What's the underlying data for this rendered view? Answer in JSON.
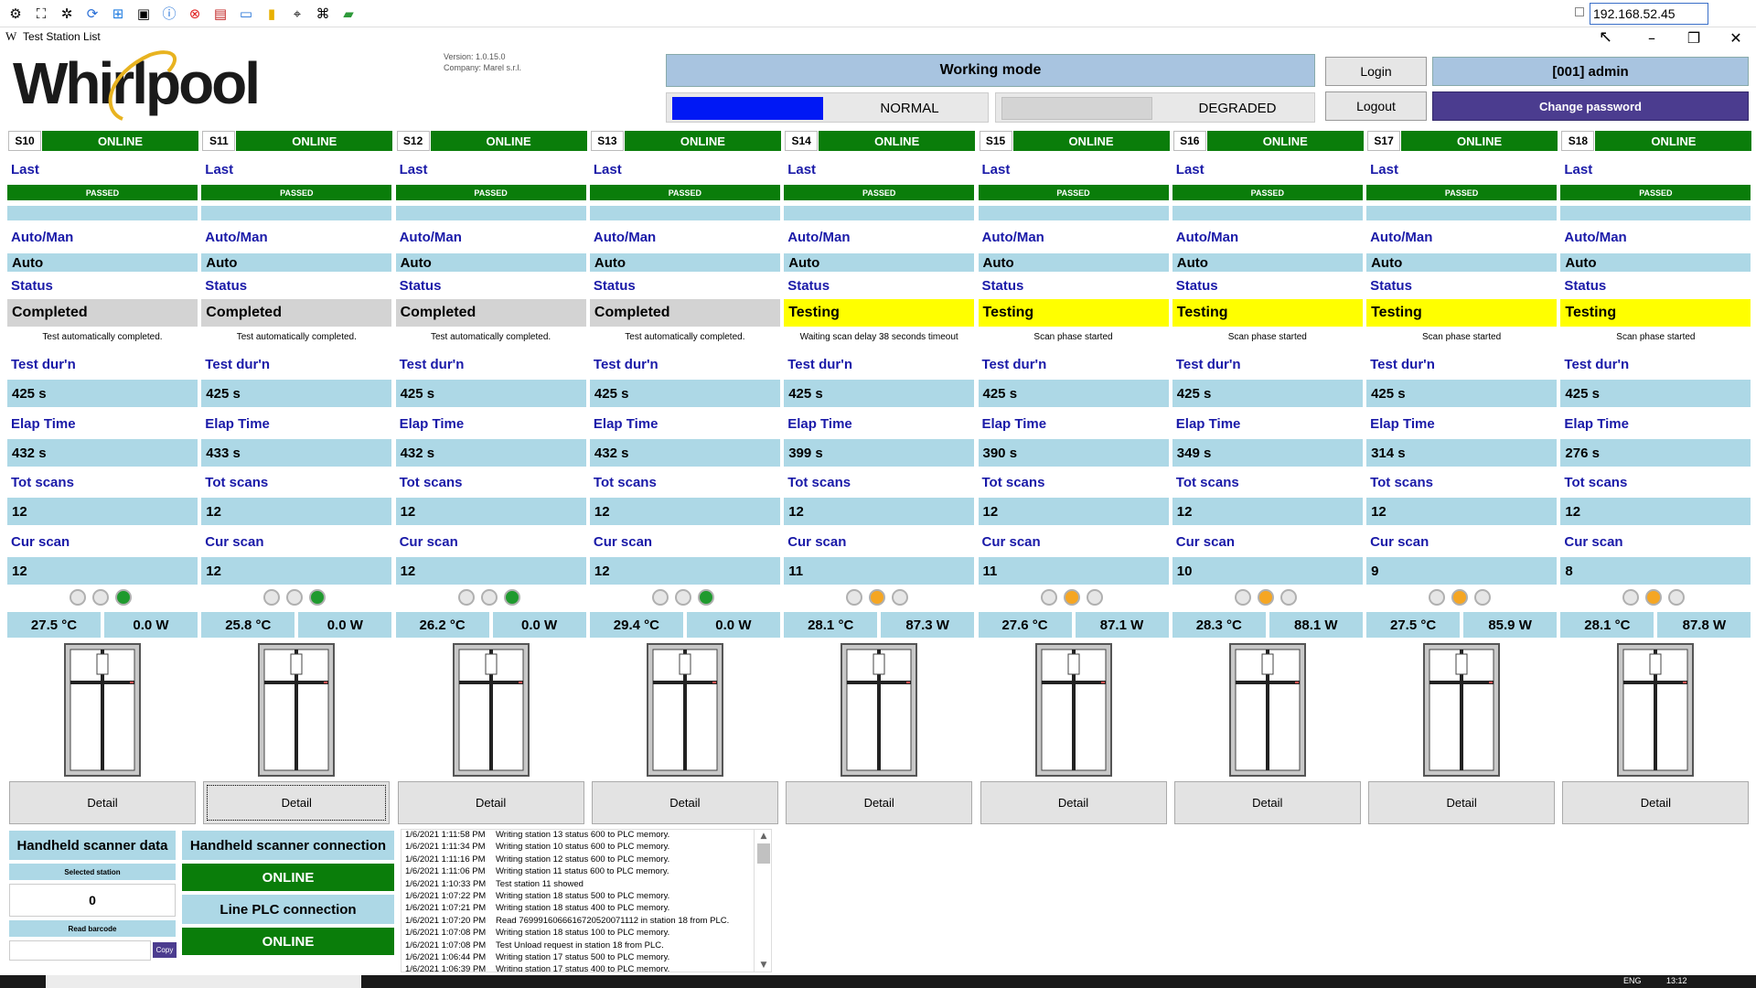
{
  "toolbar": {
    "icons": [
      "globe-gear-icon",
      "fullscreen-icon",
      "settings-icon",
      "refresh-icon",
      "windows-icon",
      "terminal-icon",
      "info-icon",
      "close-red-icon",
      "document-icon",
      "monitor-icon",
      "folder-icon",
      "network-icon",
      "network-settings-icon",
      "chat-icon"
    ],
    "ip_address": "192.168.52.45"
  },
  "window": {
    "title": "Test Station List",
    "logo_letter": "W"
  },
  "header": {
    "brand": "Whirlpool",
    "version": "Version: 1.0.15.0",
    "company": "Company: Marel s.r.l.",
    "working_mode_title": "Working mode",
    "mode_normal": "NORMAL",
    "mode_degraded": "DEGRADED",
    "login": "Login",
    "logout": "Logout",
    "user": "[001] admin",
    "change_password": "Change password"
  },
  "labels": {
    "last": "Last",
    "auto_man": "Auto/Man",
    "status": "Status",
    "test_duration": "Test dur'n",
    "elapsed": "Elap Time",
    "total_scans": "Tot scans",
    "current_scan": "Cur scan",
    "detail": "Detail"
  },
  "stations": [
    {
      "id": "S10",
      "conn": "ONLINE",
      "last": "PASSED",
      "mode": "Auto",
      "status": "Completed",
      "status_type": "completed",
      "message": "Test automatically completed.",
      "test_duration": "425 s",
      "elapsed": "432 s",
      "total_scans": "12",
      "current_scan": "12",
      "leds": [
        "off",
        "off",
        "green"
      ],
      "temp": "27.5 °C",
      "power": "0.0 W"
    },
    {
      "id": "S11",
      "conn": "ONLINE",
      "last": "PASSED",
      "mode": "Auto",
      "status": "Completed",
      "status_type": "completed",
      "message": "Test automatically completed.",
      "test_duration": "425 s",
      "elapsed": "433 s",
      "total_scans": "12",
      "current_scan": "12",
      "leds": [
        "off",
        "off",
        "green"
      ],
      "temp": "25.8 °C",
      "power": "0.0 W"
    },
    {
      "id": "S12",
      "conn": "ONLINE",
      "last": "PASSED",
      "mode": "Auto",
      "status": "Completed",
      "status_type": "completed",
      "message": "Test automatically completed.",
      "test_duration": "425 s",
      "elapsed": "432 s",
      "total_scans": "12",
      "current_scan": "12",
      "leds": [
        "off",
        "off",
        "green"
      ],
      "temp": "26.2 °C",
      "power": "0.0 W"
    },
    {
      "id": "S13",
      "conn": "ONLINE",
      "last": "PASSED",
      "mode": "Auto",
      "status": "Completed",
      "status_type": "completed",
      "message": "Test automatically completed.",
      "test_duration": "425 s",
      "elapsed": "432 s",
      "total_scans": "12",
      "current_scan": "12",
      "leds": [
        "off",
        "off",
        "green"
      ],
      "temp": "29.4 °C",
      "power": "0.0 W"
    },
    {
      "id": "S14",
      "conn": "ONLINE",
      "last": "PASSED",
      "mode": "Auto",
      "status": "Testing",
      "status_type": "testing",
      "message": "Waiting scan delay 38 seconds timeout",
      "test_duration": "425 s",
      "elapsed": "399 s",
      "total_scans": "12",
      "current_scan": "11",
      "leds": [
        "off",
        "orange",
        "off"
      ],
      "temp": "28.1 °C",
      "power": "87.3 W"
    },
    {
      "id": "S15",
      "conn": "ONLINE",
      "last": "PASSED",
      "mode": "Auto",
      "status": "Testing",
      "status_type": "testing",
      "message": "Scan phase started",
      "test_duration": "425 s",
      "elapsed": "390 s",
      "total_scans": "12",
      "current_scan": "11",
      "leds": [
        "off",
        "orange",
        "off"
      ],
      "temp": "27.6 °C",
      "power": "87.1 W"
    },
    {
      "id": "S16",
      "conn": "ONLINE",
      "last": "PASSED",
      "mode": "Auto",
      "status": "Testing",
      "status_type": "testing",
      "message": "Scan phase started",
      "test_duration": "425 s",
      "elapsed": "349 s",
      "total_scans": "12",
      "current_scan": "10",
      "leds": [
        "off",
        "orange",
        "off"
      ],
      "temp": "28.3 °C",
      "power": "88.1 W"
    },
    {
      "id": "S17",
      "conn": "ONLINE",
      "last": "PASSED",
      "mode": "Auto",
      "status": "Testing",
      "status_type": "testing",
      "message": "Scan phase started",
      "test_duration": "425 s",
      "elapsed": "314 s",
      "total_scans": "12",
      "current_scan": "9",
      "leds": [
        "off",
        "orange",
        "off"
      ],
      "temp": "27.5 °C",
      "power": "85.9 W"
    },
    {
      "id": "S18",
      "conn": "ONLINE",
      "last": "PASSED",
      "mode": "Auto",
      "status": "Testing",
      "status_type": "testing",
      "message": "Scan phase started",
      "test_duration": "425 s",
      "elapsed": "276 s",
      "total_scans": "12",
      "current_scan": "8",
      "leds": [
        "off",
        "orange",
        "off"
      ],
      "temp": "28.1 °C",
      "power": "87.8 W"
    }
  ],
  "scanner": {
    "title": "Handheld scanner data",
    "selected_station_label": "Selected station",
    "selected_station_value": "0",
    "read_barcode_label": "Read barcode",
    "barcode_value": "",
    "copy": "Copy",
    "connection_title": "Handheld scanner connection",
    "connection_status": "ONLINE",
    "plc_title": "Line PLC connection",
    "plc_status": "ONLINE"
  },
  "log": [
    {
      "time": "1/6/2021 1:11:58 PM",
      "msg": "Writing station 13 status 600 to PLC memory."
    },
    {
      "time": "1/6/2021 1:11:34 PM",
      "msg": "Writing station 10 status 600 to PLC memory."
    },
    {
      "time": "1/6/2021 1:11:16 PM",
      "msg": "Writing station 12 status 600 to PLC memory."
    },
    {
      "time": "1/6/2021 1:11:06 PM",
      "msg": "Writing station 11 status 600 to PLC memory."
    },
    {
      "time": "1/6/2021 1:10:33 PM",
      "msg": "Test station  11 showed"
    },
    {
      "time": "1/6/2021 1:07:22 PM",
      "msg": "Writing station 18 status 500 to PLC memory."
    },
    {
      "time": "1/6/2021 1:07:21 PM",
      "msg": "Writing station 18 status 400 to PLC memory."
    },
    {
      "time": "1/6/2021 1:07:20 PM",
      "msg": "Read 7699916066616720520071112        in station 18 from PLC."
    },
    {
      "time": "1/6/2021 1:07:08 PM",
      "msg": "Writing station 18 status 100 to PLC memory."
    },
    {
      "time": "1/6/2021 1:07:08 PM",
      "msg": "Test Unload request in station 18 from PLC."
    },
    {
      "time": "1/6/2021 1:06:44 PM",
      "msg": "Writing station 17 status 500 to PLC memory."
    },
    {
      "time": "1/6/2021 1:06:39 PM",
      "msg": "Writing station 17 status 400 to PLC memory."
    }
  ],
  "taskbar": {
    "lang": "ENG",
    "time": "13:12"
  },
  "colors": {
    "online_green": "#0a7d0a",
    "light_blue": "#add8e6",
    "label_blue": "#1a1aa8",
    "testing_yellow": "#ffff00",
    "normal_blue": "#0018f5",
    "purple": "#4b3c8f"
  }
}
